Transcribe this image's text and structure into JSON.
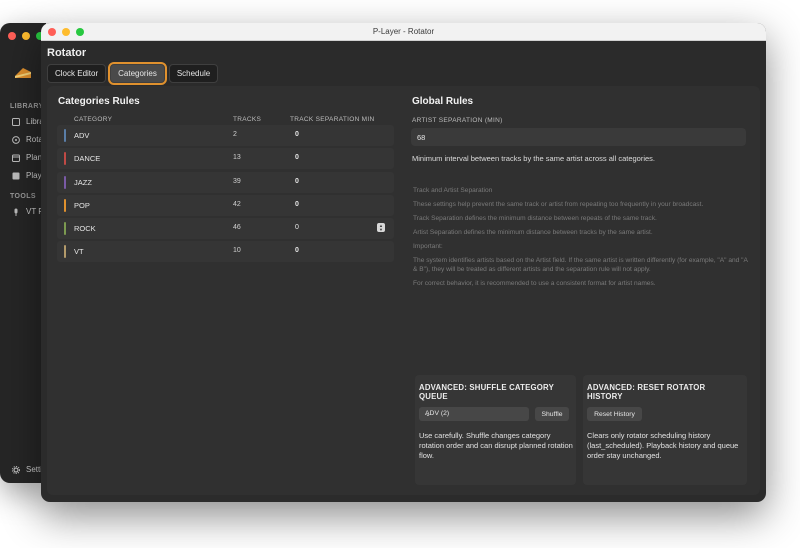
{
  "back_window": {
    "sidebar": {
      "library_label": "LIBRARY",
      "tools_label": "TOOLS",
      "items": [
        {
          "label": "Libra",
          "icon": "library-icon"
        },
        {
          "label": "Rota",
          "icon": "rotator-icon"
        },
        {
          "label": "Plan",
          "icon": "planner-icon"
        },
        {
          "label": "Play",
          "icon": "playlist-icon"
        }
      ],
      "tools": [
        {
          "label": "VT R",
          "icon": "microphone-icon"
        }
      ],
      "settings_label": "Setti"
    }
  },
  "window": {
    "title": "P-Layer - Rotator"
  },
  "page_title": "Rotator",
  "tabs": [
    {
      "label": "Clock Editor",
      "active": false
    },
    {
      "label": "Categories",
      "active": true
    },
    {
      "label": "Schedule",
      "active": false
    }
  ],
  "categories": {
    "title": "Categories Rules",
    "columns": {
      "category": "CATEGORY",
      "tracks": "TRACKS",
      "separation": "TRACK SEPARATION MIN"
    },
    "rows": [
      {
        "name": "ADV",
        "tracks": "2",
        "separation": "0",
        "color": "#5a7ea8"
      },
      {
        "name": "DANCE",
        "tracks": "13",
        "separation": "0",
        "color": "#c04a45"
      },
      {
        "name": "JAZZ",
        "tracks": "39",
        "separation": "0",
        "color": "#7a5aa6"
      },
      {
        "name": "POP",
        "tracks": "42",
        "separation": "0",
        "color": "#e0912e"
      },
      {
        "name": "ROCK",
        "tracks": "46",
        "separation": "0",
        "color": "#7c9a50"
      },
      {
        "name": "VT",
        "tracks": "10",
        "separation": "0",
        "color": "#b39a6a"
      }
    ]
  },
  "global_rules": {
    "title": "Global Rules",
    "artist_sep_label": "ARTIST SEPARATION (MIN)",
    "artist_sep_value": "68",
    "description": "Minimum interval between tracks by the same artist across all categories.",
    "info": {
      "heading": "Track and Artist Separation",
      "p1": "These settings help prevent the same track or artist from repeating too frequently in your broadcast.",
      "p2": "Track Separation defines the minimum distance between repeats of the same track.",
      "p3": "Artist Separation defines the minimum distance between tracks by the same artist.",
      "important": "Important:",
      "p4": "The system identifies artists based on the Artist field. If the same artist is written differently (for example, \"A\" and \"A & B\"), they will be treated as different artists and the separation rule will not apply.",
      "p5": "For correct behavior, it is recommended to use a consistent format for artist names."
    }
  },
  "shuffle_card": {
    "title": "ADVANCED: SHUFFLE CATEGORY QUEUE",
    "select_value": "ADV (2)",
    "button": "Shuffle",
    "text": "Use carefully. Shuffle changes category rotation order and can disrupt planned rotation flow."
  },
  "reset_card": {
    "title": "ADVANCED: RESET ROTATOR HISTORY",
    "button": "Reset History",
    "text": "Clears only rotator scheduling history (last_scheduled). Playback history and queue order stay unchanged."
  },
  "colors": {
    "accent": "#e0912e"
  }
}
